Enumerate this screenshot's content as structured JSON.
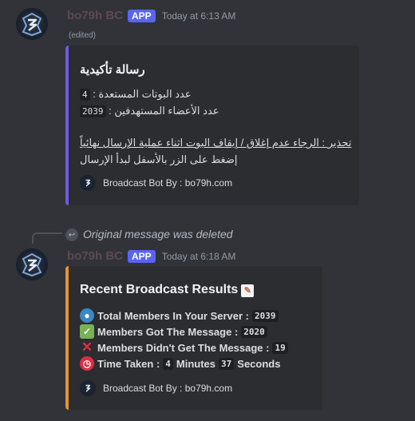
{
  "message1": {
    "username": "bo79h BC",
    "badge": "APP",
    "timestamp": "Today at 6:13 AM",
    "edited": "(edited)",
    "embed": {
      "title": "رسالة تأكيدية",
      "line1_label": "عدد البوتات المستعدة :",
      "line1_value": "4",
      "line2_label": "عدد الأعضاء المستهدفين :",
      "line2_value": "2039",
      "warning": "تحذير : الرجاء عدم إغلاق / إيقاف البوت اثناء عملية الإرسال نهائياً",
      "instruction": "إضغط على الزر بالأسفل لبدأ الإرسال",
      "footer": "Broadcast Bot By : bo79h.com"
    }
  },
  "reply": {
    "text": "Original message was deleted"
  },
  "message2": {
    "username": "bo79h BC",
    "badge": "APP",
    "timestamp": "Today at 6:18 AM",
    "embed": {
      "title": "Recent Broadcast Results",
      "total_label": "Total Members In Your Server :",
      "total_value": "2039",
      "got_label": "Members Got The Message :",
      "got_value": "2020",
      "failed_label": "Members Didn't Get The Message :",
      "failed_value": "19",
      "time_label": "Time Taken :",
      "time_minutes": "4",
      "time_minutes_unit": "Minutes",
      "time_seconds": "37",
      "time_seconds_unit": "Seconds",
      "footer": "Broadcast Bot By : bo79h.com"
    }
  },
  "colors": {
    "embed1_accent": "#6f58e8",
    "embed2_accent": "#e6932e",
    "app_badge": "#5865f2"
  }
}
